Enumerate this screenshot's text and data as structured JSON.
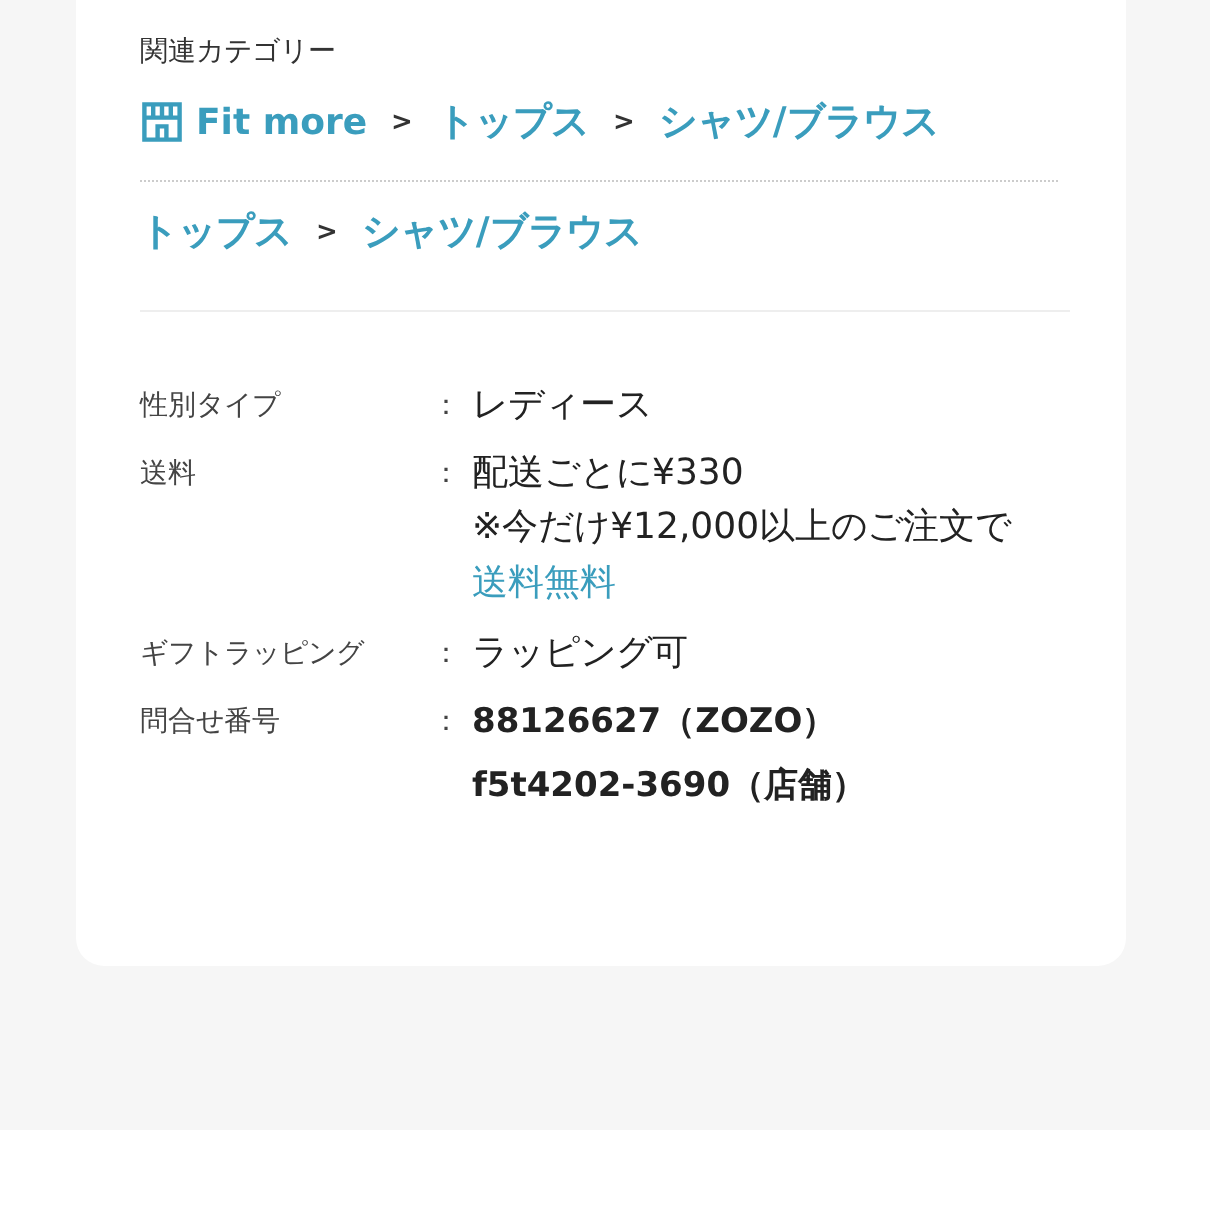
{
  "related_categories": {
    "label": "関連カテゴリー",
    "paths": [
      {
        "crumbs": [
          {
            "kind": "shop",
            "text": "Fit more"
          },
          {
            "kind": "separator",
            "text": ">"
          },
          {
            "kind": "link",
            "text": "トップス"
          },
          {
            "kind": "separator",
            "text": ">"
          },
          {
            "kind": "link",
            "text": "シャツ/ブラウス"
          }
        ]
      },
      {
        "crumbs": [
          {
            "kind": "link",
            "text": "トップス"
          },
          {
            "kind": "separator",
            "text": ">"
          },
          {
            "kind": "link",
            "text": "シャツ/ブラウス"
          }
        ]
      }
    ]
  },
  "specs": [
    {
      "label": "性別タイプ",
      "separator": "：",
      "lines": [
        {
          "kind": "text",
          "text": "レディース"
        }
      ]
    },
    {
      "label": "送料",
      "separator": "：",
      "lines": [
        {
          "kind": "text",
          "text": "配送ごとに¥330"
        },
        {
          "kind": "text",
          "text": "※今だけ¥12,000以上のご注文で"
        },
        {
          "kind": "link",
          "text": "送料無料"
        }
      ]
    },
    {
      "label": "ギフトラッピング",
      "separator": "：",
      "lines": [
        {
          "kind": "text",
          "text": "ラッピング可"
        }
      ]
    },
    {
      "label": "問合せ番号",
      "separator": "：",
      "lines": [
        {
          "kind": "id",
          "text": "88126627（ZOZO）"
        },
        {
          "kind": "id",
          "text": "f5t4202-3690（店舗）"
        }
      ]
    }
  ]
}
